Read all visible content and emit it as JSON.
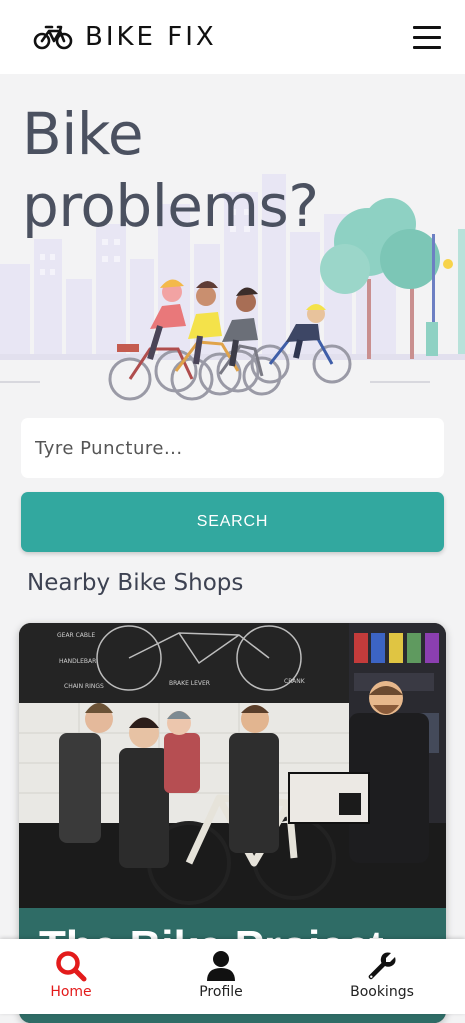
{
  "header": {
    "brand": "BIKE FIX",
    "logo_icon": "bicycle-icon",
    "menu_icon": "hamburger-menu-icon"
  },
  "hero": {
    "title_line1": "Bike",
    "title_line2": "problems?",
    "illustration": "cyclists-in-city-illustration"
  },
  "search": {
    "placeholder": "Tyre Puncture...",
    "value": "",
    "button_label": "SEARCH"
  },
  "nearby": {
    "title": "Nearby Bike Shops",
    "shops": [
      {
        "name": "The Bike Project",
        "photo": "bike-shop-team-photo"
      }
    ]
  },
  "bottom_nav": {
    "items": [
      {
        "label": "Home",
        "icon": "search-icon",
        "active": true
      },
      {
        "label": "Profile",
        "icon": "user-icon",
        "active": false
      },
      {
        "label": "Bookings",
        "icon": "wrench-icon",
        "active": false
      }
    ]
  },
  "colors": {
    "accent": "#32a89f",
    "active_nav": "#e31b1b",
    "title_text": "#4b5160",
    "card_banner": "#2f6c66",
    "page_bg": "#f3f3f4"
  }
}
